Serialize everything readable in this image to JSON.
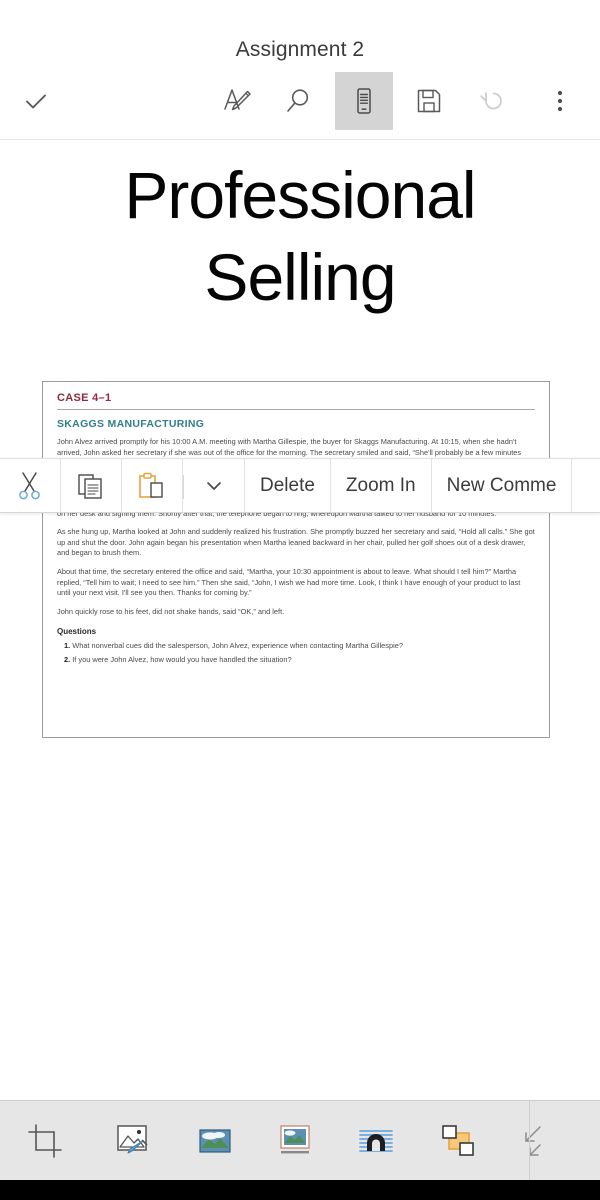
{
  "header": {
    "title": "Assignment 2",
    "icons": [
      {
        "name": "done-checkmark-icon",
        "label": "Done"
      },
      {
        "name": "ink-pen-icon",
        "label": "Draw"
      },
      {
        "name": "search-icon",
        "label": "Find"
      },
      {
        "name": "reading-view-icon",
        "label": "Mobile View",
        "selected": true
      },
      {
        "name": "save-icon",
        "label": "Save"
      },
      {
        "name": "undo-icon",
        "label": "Undo",
        "disabled": true
      },
      {
        "name": "more-options-icon",
        "label": "More options"
      }
    ]
  },
  "page": {
    "heading_line1": "Professional",
    "heading_line2": "Selling"
  },
  "context_toolbar": {
    "items": [
      {
        "name": "cut-button",
        "icon": "scissors-icon",
        "label": ""
      },
      {
        "name": "copy-button",
        "icon": "copy-pages-icon",
        "label": ""
      },
      {
        "name": "paste-button",
        "icon": "clipboard-paste-icon",
        "label": ""
      },
      {
        "name": "paste-options-dropdown",
        "icon": "chevron-down-icon",
        "label": ""
      },
      {
        "name": "delete-button",
        "icon": "",
        "label": "Delete"
      },
      {
        "name": "zoom-in-button",
        "icon": "",
        "label": "Zoom In"
      },
      {
        "name": "new-comment-button",
        "icon": "",
        "label": "New Comme"
      }
    ]
  },
  "document": {
    "case_label": "CASE 4–1",
    "company": "SKAGGS MANUFACTURING",
    "paragraphs": [
      "John Alvez arrived promptly for his 10:00 A.M. meeting with Martha Gillespie, the buyer for Skaggs Manufacturing. At 10:15, when she hadn't arrived, John asked her secretary if she was out of the office for the morning. The secretary smiled and said, “She'll probably be a few minutes late.” John resented this delay and was convinced that Martha had forgotten the appointment.",
      "Finally, at 10:20, Martha entered her office, walked over to John, said hello, and promptly excused herself to talk to the secretary about a tennis game scheduled for that afternoon. Ten minutes later, Martha led John into her office. At the same time, a competing salesperson entered the office for a 10:30 appointment. With the door open, Martha asked John, “What's new today?” As John began to talk, Martha began reading letters on her desk and signing them. Shortly after that, the telephone began to ring, whereupon Martha talked to her husband for 10 minutes.",
      "As she hung up, Martha looked at John and suddenly realized his frustration. She promptly buzzed her secretary and said, “Hold all calls.” She got up and shut the door. John again began his presentation when Martha leaned backward in her chair, pulled her golf shoes out of a desk drawer, and began to brush them.",
      "About that time, the secretary entered the office and said, “Martha, your 10:30 appointment is about to leave. What should I tell him?” Martha replied, “Tell him to wait; I need to see him.” Then she said, “John, I wish we had more time. Look, I think I have enough of your product to last until your next visit. I'll see you then. Thanks for coming by.”",
      "John quickly rose to his feet, did not shake hands, said “OK,” and left."
    ],
    "questions_heading": "Questions",
    "questions": [
      {
        "number": "1.",
        "text": "What nonverbal cues did the salesperson, John Alvez, experience when contacting Martha Gillespie?"
      },
      {
        "number": "2.",
        "text": "If you were John Alvez, how would you have handled the situation?"
      }
    ]
  },
  "bottom_toolbar": {
    "items": [
      {
        "name": "crop-icon",
        "label": "Crop"
      },
      {
        "name": "picture-styles-icon",
        "label": "Picture Styles"
      },
      {
        "name": "picture-fill-icon",
        "label": "Picture Fill"
      },
      {
        "name": "picture-border-icon",
        "label": "Picture Border"
      },
      {
        "name": "picture-effects-icon",
        "label": "Picture Effects"
      },
      {
        "name": "arrange-objects-icon",
        "label": "Arrange"
      },
      {
        "name": "reset-picture-icon",
        "label": "Reset Picture"
      },
      {
        "name": "collapse-ribbon-icon",
        "label": "Collapse"
      }
    ]
  },
  "colors": {
    "case_label": "#8e2a3b",
    "company_label": "#2f7f8f",
    "selected_tool_bg": "#d4d4d4",
    "bottom_bar_bg": "#e6e6e6",
    "accent_orange": "#e8a33d",
    "accent_blue": "#4a90c4"
  }
}
